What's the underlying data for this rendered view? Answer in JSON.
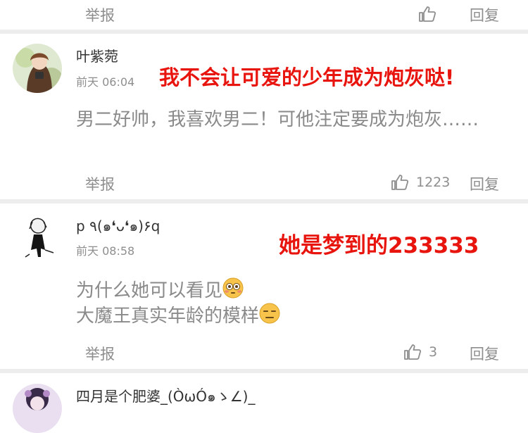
{
  "actions": {
    "report_label": "举报",
    "reply_label": "回复"
  },
  "comments": [
    {
      "username": "叶紫菀",
      "time": "前天 06:04",
      "text": "男二好帅，我喜欢男二！可他注定要成为炮灰……",
      "likes": "1223",
      "overlay": "我不会让可爱的少年成为炮灰哒!"
    },
    {
      "username": "p ٩(๑❛ᴗ❛๑)۶q",
      "time": "前天 08:58",
      "text_line1": "为什么她可以看见",
      "text_line2": "大魔王真实年龄的模样",
      "likes": "3",
      "overlay": "她是梦到的233333"
    },
    {
      "username": "四月是个肥婆_(ÒωÓ๑ゝ∠)_"
    }
  ],
  "colors": {
    "overlay_red": "#e8140e",
    "gray_text": "#8e8e8e",
    "divider": "#ededed"
  }
}
